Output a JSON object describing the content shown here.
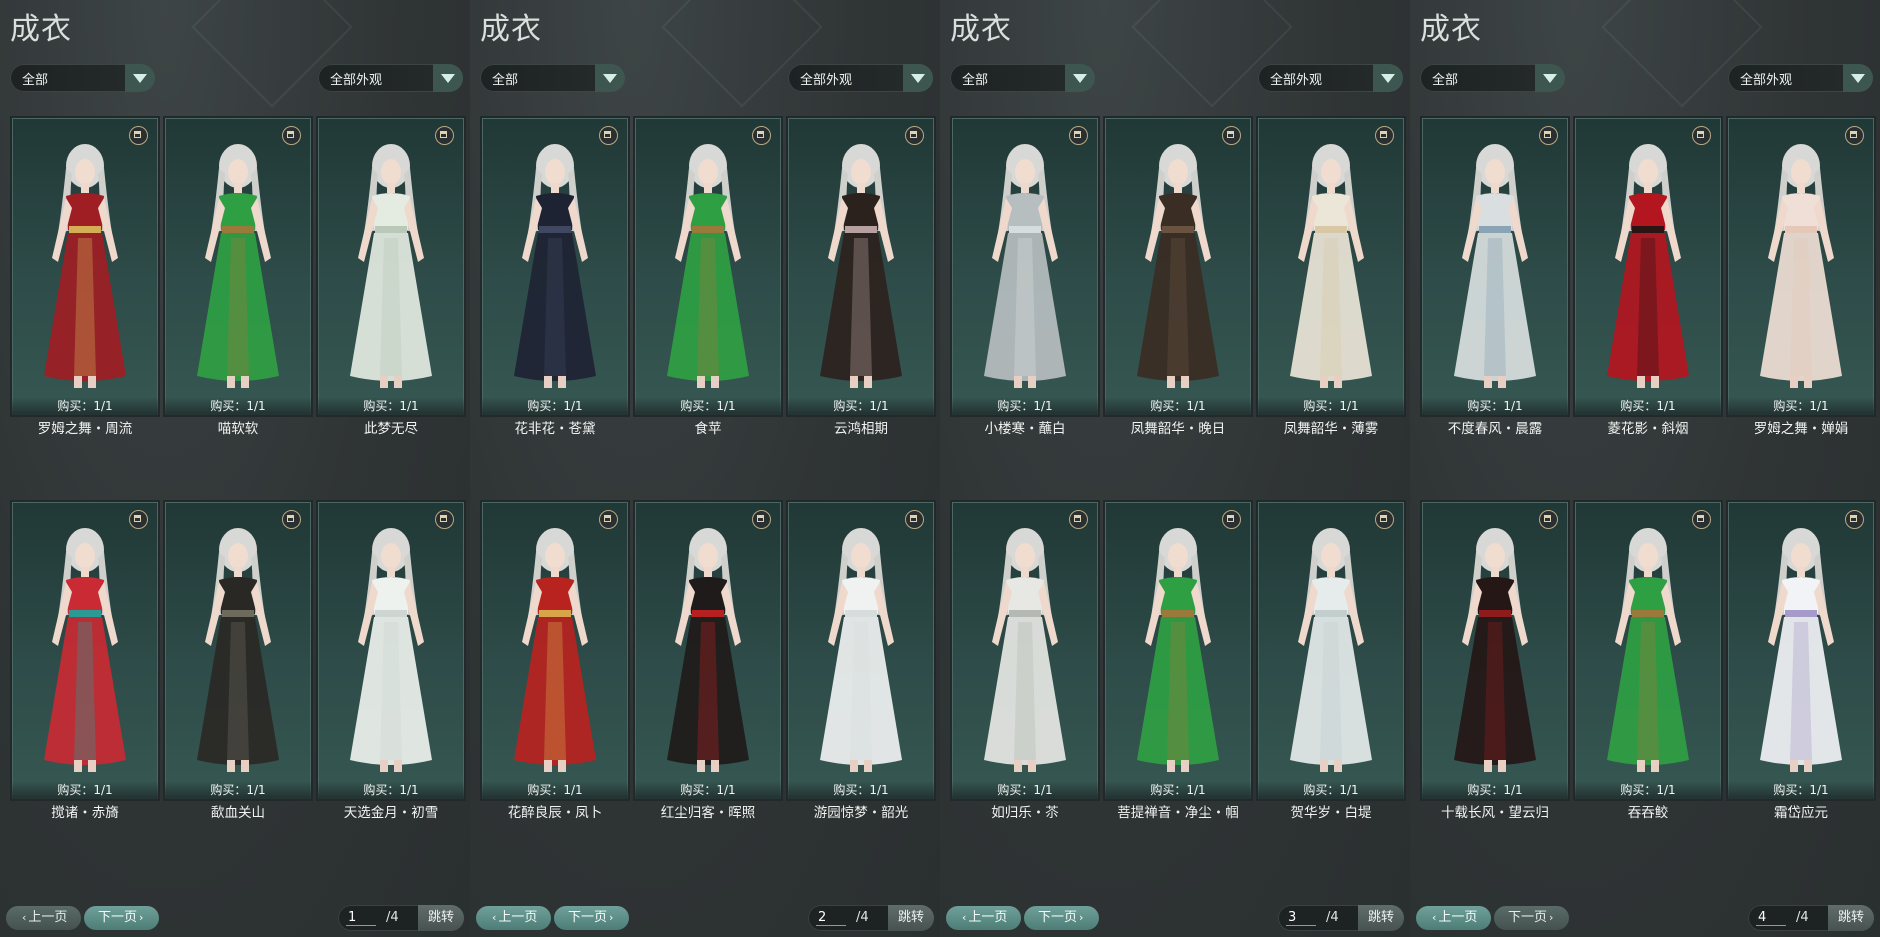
{
  "panels": [
    {
      "title": "成衣",
      "filter1": "全部",
      "filter2": "全部外观",
      "page": "1",
      "total": "/4",
      "prev": "上一页",
      "next": "下一页",
      "jump": "跳转",
      "prev_active": false,
      "next_active": true,
      "items": [
        {
          "name": "罗姆之舞・周流",
          "buy": "购买：1/1",
          "dress": "#9e1e24",
          "accent": "#d5ad55",
          "tag": "trash-icon"
        },
        {
          "name": "喵软软",
          "buy": "购买：1/1",
          "dress": "#2f9f43",
          "accent": "#9a7a3a",
          "tag": "trash-icon"
        },
        {
          "name": "此梦无尽",
          "buy": "购买：1/1",
          "dress": "#e4ece2",
          "accent": "#b9c8b9",
          "tag": "no-trash-icon"
        },
        {
          "name": "搅诸・赤旖",
          "buy": "购买：1/1",
          "dress": "#c92a33",
          "accent": "#2a9a95",
          "tag": "trash-icon"
        },
        {
          "name": "歃血关山",
          "buy": "购买：1/1",
          "dress": "#2a2825",
          "accent": "#6e6a5e",
          "tag": "trash-icon"
        },
        {
          "name": "天选金月・初雪",
          "buy": "购买：1/1",
          "dress": "#eef2ee",
          "accent": "#cdd6d2",
          "tag": "trash-icon"
        }
      ]
    },
    {
      "title": "成衣",
      "filter1": "全部",
      "filter2": "全部外观",
      "page": "2",
      "total": "/4",
      "prev": "上一页",
      "next": "下一页",
      "jump": "跳转",
      "prev_active": true,
      "next_active": true,
      "items": [
        {
          "name": "花非花・苍黛",
          "buy": "购买：1/1",
          "dress": "#1e2333",
          "accent": "#3f4761",
          "tag": "trash-icon"
        },
        {
          "name": "食苹",
          "buy": "购买：1/1",
          "dress": "#2f9f43",
          "accent": "#9a7a3a",
          "tag": "trash-icon"
        },
        {
          "name": "云鸿相期",
          "buy": "购买：1/1",
          "dress": "#2c221d",
          "accent": "#b7a0a0",
          "tag": "trash-icon"
        },
        {
          "name": "花醉良辰・凤卜",
          "buy": "购买：1/1",
          "dress": "#b8231f",
          "accent": "#d8a54a",
          "tag": "trash-icon"
        },
        {
          "name": "红尘归客・晖照",
          "buy": "购买：1/1",
          "dress": "#1f1b1a",
          "accent": "#b52020",
          "tag": "trash-icon"
        },
        {
          "name": "游园惊梦・韶光",
          "buy": "购买：1/1",
          "dress": "#f0f2f2",
          "accent": "#d7dcdc",
          "tag": "trash-icon"
        }
      ]
    },
    {
      "title": "成衣",
      "filter1": "全部",
      "filter2": "全部外观",
      "page": "3",
      "total": "/4",
      "prev": "上一页",
      "next": "下一页",
      "jump": "跳转",
      "prev_active": true,
      "next_active": true,
      "items": [
        {
          "name": "小楼寒・蘸白",
          "buy": "购买：1/1",
          "dress": "#b7bec0",
          "accent": "#d7dcde",
          "tag": "no-trash-icon"
        },
        {
          "name": "凤舞韶华・晚日",
          "buy": "购买：1/1",
          "dress": "#3a2d24",
          "accent": "#6a5240",
          "tag": "trash-icon"
        },
        {
          "name": "凤舞韶华・薄雾",
          "buy": "购买：1/1",
          "dress": "#ece6d8",
          "accent": "#d8c8a6",
          "tag": "trash-icon"
        },
        {
          "name": "如归乐・苶",
          "buy": "购买：1/1",
          "dress": "#e7e8e4",
          "accent": "#b5b9b3",
          "tag": "trash-icon"
        },
        {
          "name": "菩提禅音・净尘・帼",
          "buy": "购买：1/1",
          "dress": "#2f9f43",
          "accent": "#9a7a3a",
          "tag": "trash-icon"
        },
        {
          "name": "贺华岁・白堤",
          "buy": "购买：1/1",
          "dress": "#e6ecec",
          "accent": "#c3cfcf",
          "tag": "trash-icon"
        }
      ]
    },
    {
      "title": "成衣",
      "filter1": "全部",
      "filter2": "全部外观",
      "page": "4",
      "total": "/4",
      "prev": "上一页",
      "next": "下一页",
      "jump": "跳转",
      "prev_active": true,
      "next_active": false,
      "items": [
        {
          "name": "不度春风・晨露",
          "buy": "购买：1/1",
          "dress": "#d9dfe0",
          "accent": "#8aa4b5",
          "tag": "trash-icon"
        },
        {
          "name": "菱花影・斜烟",
          "buy": "购买：1/1",
          "dress": "#b3161f",
          "accent": "#2a1414",
          "tag": "trash-icon"
        },
        {
          "name": "罗姆之舞・婵娟",
          "buy": "购买：1/1",
          "dress": "#f0dfd6",
          "accent": "#e6c8b8",
          "tag": "trash-icon"
        },
        {
          "name": "十载长风・望云归",
          "buy": "购买：1/1",
          "dress": "#241716",
          "accent": "#8e1c1c",
          "tag": "trash-icon"
        },
        {
          "name": "吞吞鲛",
          "buy": "购买：1/1",
          "dress": "#2f9f43",
          "accent": "#9a7a3a",
          "tag": "trash-icon"
        },
        {
          "name": "霜岱应元",
          "buy": "购买：1/1",
          "dress": "#f2f3f6",
          "accent": "#a69ac8",
          "tag": "trash-icon"
        }
      ]
    }
  ]
}
